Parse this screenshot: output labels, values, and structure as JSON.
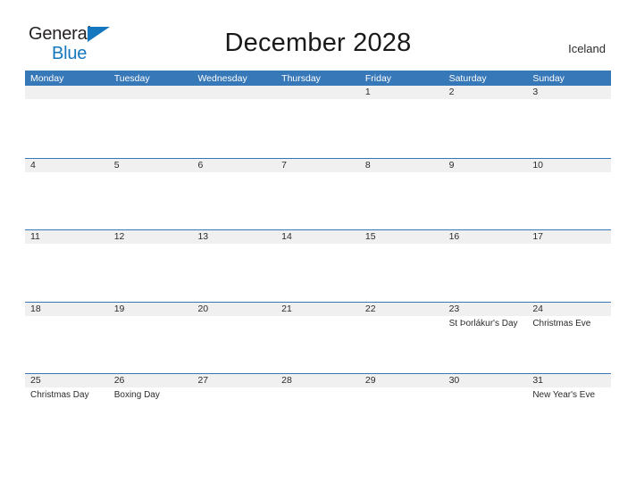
{
  "brand": {
    "name_part1": "General",
    "name_part2": "Blue",
    "triangle_color": "#1577bd",
    "text_color": "#231f20"
  },
  "header": {
    "title": "December 2028",
    "country": "Iceland",
    "header_bg_color": "#3778b8",
    "day_band_color": "#f0f0f0"
  },
  "calendar": {
    "weekdays": [
      "Monday",
      "Tuesday",
      "Wednesday",
      "Thursday",
      "Friday",
      "Saturday",
      "Sunday"
    ],
    "weeks": [
      [
        {
          "day": "",
          "events": []
        },
        {
          "day": "",
          "events": []
        },
        {
          "day": "",
          "events": []
        },
        {
          "day": "",
          "events": []
        },
        {
          "day": "1",
          "events": []
        },
        {
          "day": "2",
          "events": []
        },
        {
          "day": "3",
          "events": []
        }
      ],
      [
        {
          "day": "4",
          "events": []
        },
        {
          "day": "5",
          "events": []
        },
        {
          "day": "6",
          "events": []
        },
        {
          "day": "7",
          "events": []
        },
        {
          "day": "8",
          "events": []
        },
        {
          "day": "9",
          "events": []
        },
        {
          "day": "10",
          "events": []
        }
      ],
      [
        {
          "day": "11",
          "events": []
        },
        {
          "day": "12",
          "events": []
        },
        {
          "day": "13",
          "events": []
        },
        {
          "day": "14",
          "events": []
        },
        {
          "day": "15",
          "events": []
        },
        {
          "day": "16",
          "events": []
        },
        {
          "day": "17",
          "events": []
        }
      ],
      [
        {
          "day": "18",
          "events": []
        },
        {
          "day": "19",
          "events": []
        },
        {
          "day": "20",
          "events": []
        },
        {
          "day": "21",
          "events": []
        },
        {
          "day": "22",
          "events": []
        },
        {
          "day": "23",
          "events": [
            "St Þorlákur's Day"
          ]
        },
        {
          "day": "24",
          "events": [
            "Christmas Eve"
          ]
        }
      ],
      [
        {
          "day": "25",
          "events": [
            "Christmas Day"
          ]
        },
        {
          "day": "26",
          "events": [
            "Boxing Day"
          ]
        },
        {
          "day": "27",
          "events": []
        },
        {
          "day": "28",
          "events": []
        },
        {
          "day": "29",
          "events": []
        },
        {
          "day": "30",
          "events": []
        },
        {
          "day": "31",
          "events": [
            "New Year's Eve"
          ]
        }
      ]
    ]
  }
}
